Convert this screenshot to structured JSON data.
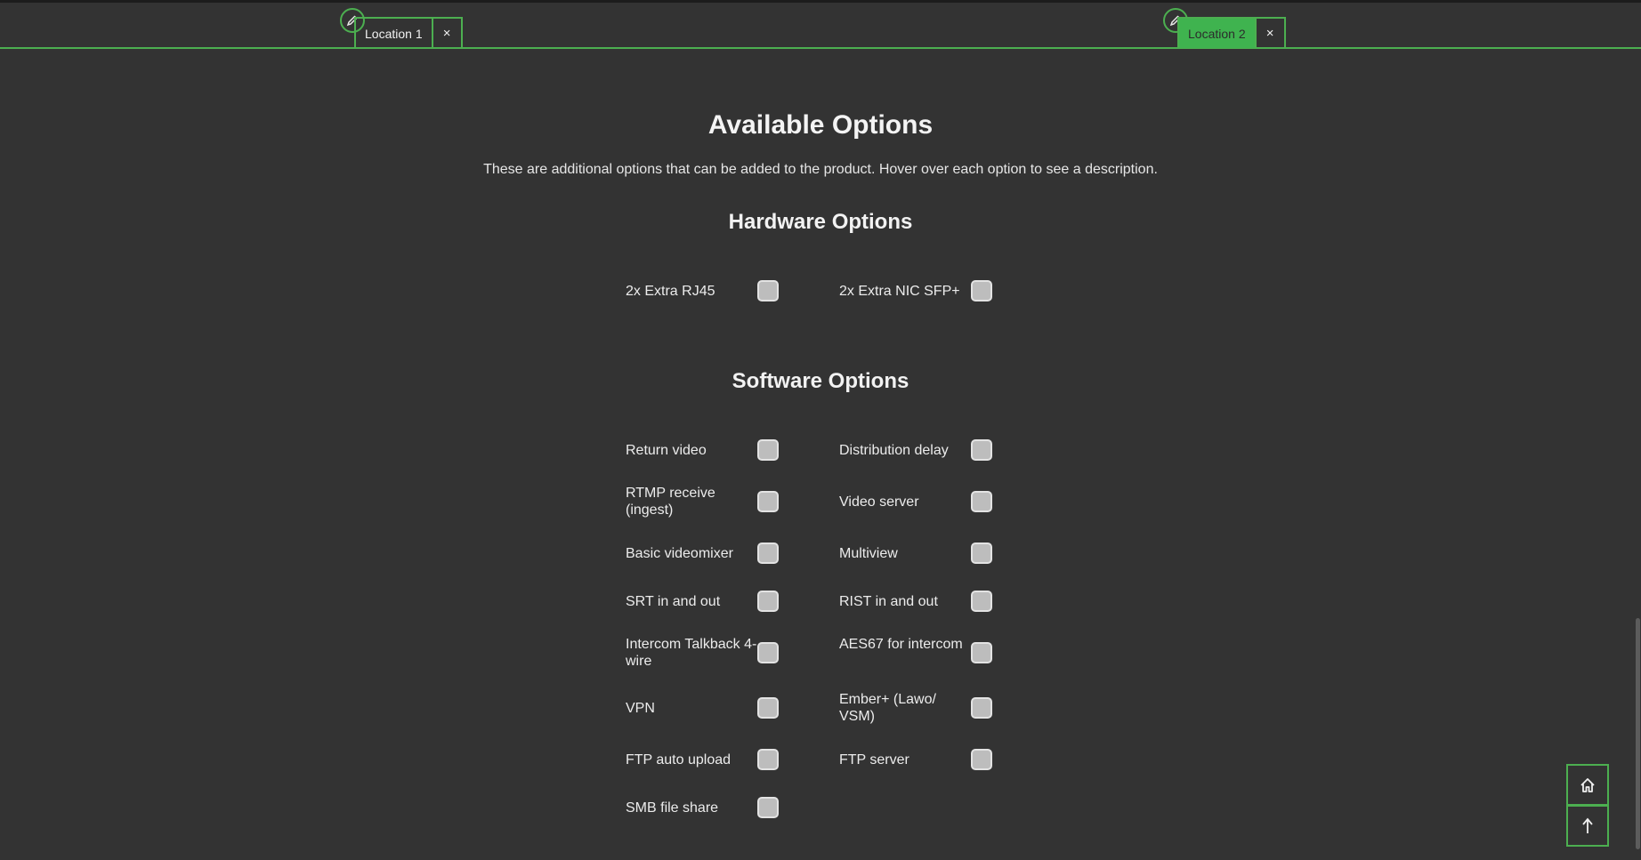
{
  "tabs": [
    {
      "label": "Location 1",
      "close": "×",
      "active": false
    },
    {
      "label": "Location 2",
      "close": "×",
      "active": true
    }
  ],
  "main": {
    "title": "Available Options",
    "description": "These are additional options that can be added to the product. Hover over each option to see a description."
  },
  "hardware": {
    "title": "Hardware Options",
    "options": [
      "2x Extra RJ45",
      "2x Extra NIC SFP+"
    ]
  },
  "software": {
    "title": "Software Options",
    "options": [
      "Return video",
      "Distribution delay",
      "RTMP receive (ingest)",
      "Video server",
      "Basic videomixer",
      "Multiview",
      "SRT in and out",
      "RIST in and out",
      "Intercom Talkback 4-wire",
      "AES67 for intercom",
      "VPN",
      "Ember+ (Lawo/ VSM)",
      "FTP auto upload",
      "FTP server",
      "SMB file share"
    ]
  },
  "icons": {
    "edit": "pencil-icon",
    "home": "home-icon",
    "scroll_top": "arrow-up-icon"
  },
  "colors": {
    "background": "#333333",
    "accent": "#4caf50",
    "checkbox": "#bdbdbd"
  }
}
